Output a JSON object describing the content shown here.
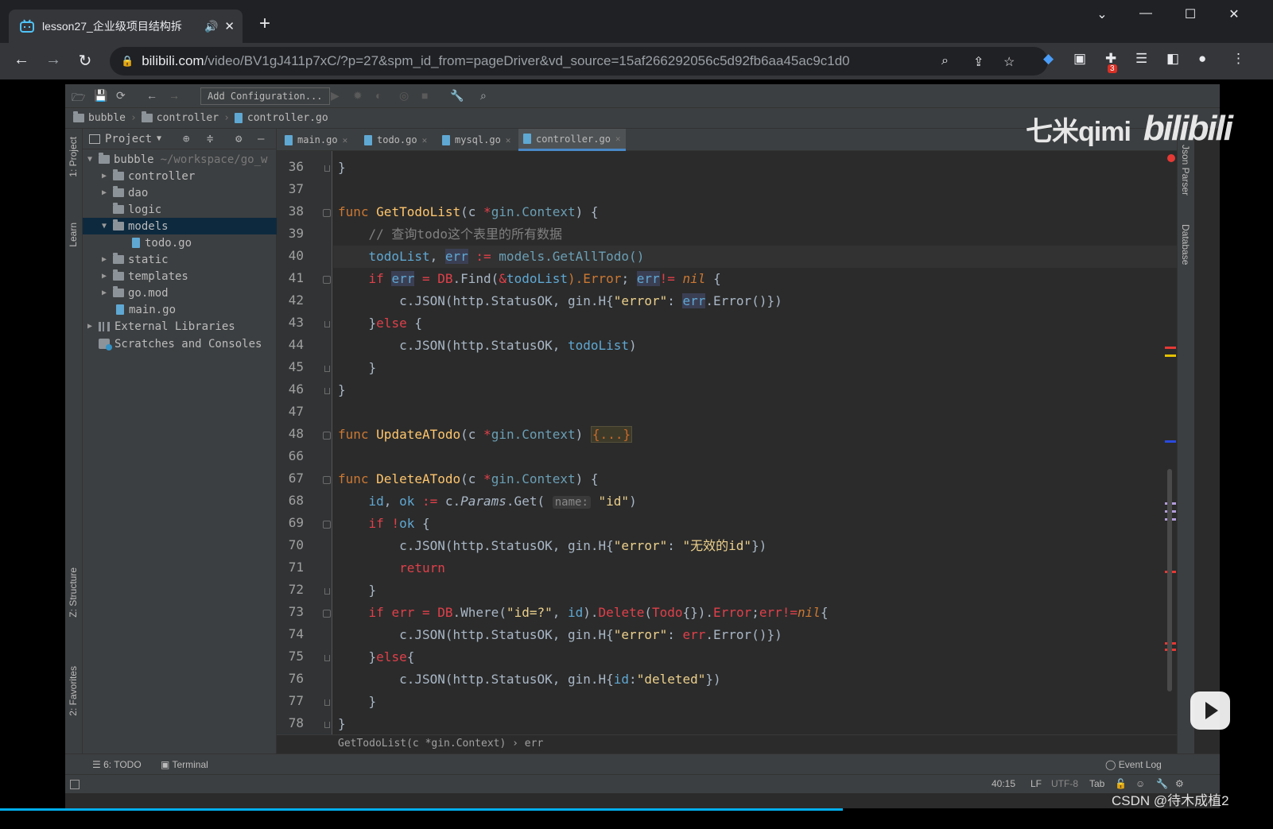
{
  "browser": {
    "tab_title": "lesson27_企业级项目结构拆",
    "url_host": "bilibili.com",
    "url_path": "/video/BV1gJ411p7xC/?p=27&spm_id_from=pageDriver&vd_source=15af266292056c5d92fb6aa45ac9c1d0",
    "extension_badge": "3"
  },
  "ide": {
    "toolbar": {
      "add_config_label": "Add Configuration..."
    },
    "breadcrumb": [
      "bubble",
      "controller",
      "controller.go"
    ],
    "left_tool_tabs": [
      "1: Project",
      "Learn",
      "Z: Structure",
      "2: Favorites"
    ],
    "right_tool_tabs": [
      "Json Parser",
      "Database"
    ],
    "project_panel": {
      "title": "Project",
      "tree": [
        {
          "label": "bubble",
          "hint": "~/workspace/go_w",
          "type": "folder",
          "expanded": true
        },
        {
          "label": "controller",
          "type": "folder"
        },
        {
          "label": "dao",
          "type": "folder"
        },
        {
          "label": "logic",
          "type": "folder"
        },
        {
          "label": "models",
          "type": "folder",
          "expanded": true,
          "selected": true
        },
        {
          "label": "todo.go",
          "type": "gofile"
        },
        {
          "label": "static",
          "type": "folder"
        },
        {
          "label": "templates",
          "type": "folder"
        },
        {
          "label": "go.mod",
          "type": "file"
        },
        {
          "label": "main.go",
          "type": "gofile"
        },
        {
          "label": "External Libraries",
          "type": "library"
        },
        {
          "label": "Scratches and Consoles",
          "type": "scratch"
        }
      ]
    },
    "editor_tabs": [
      {
        "label": "main.go",
        "active": false
      },
      {
        "label": "todo.go",
        "active": false
      },
      {
        "label": "mysql.go",
        "active": false
      },
      {
        "label": "controller.go",
        "active": true
      }
    ],
    "line_numbers": [
      "36",
      "37",
      "38",
      "39",
      "40",
      "41",
      "42",
      "43",
      "44",
      "45",
      "46",
      "47",
      "48",
      "66",
      "67",
      "68",
      "69",
      "70",
      "71",
      "72",
      "73",
      "74",
      "75",
      "76",
      "77",
      "78"
    ],
    "code": {
      "l36": "}",
      "l38_func": "func",
      "l38_name": "GetTodoList",
      "l38_params_a": "(c ",
      "l38_star": "*",
      "l38_type": "gin.Context",
      "l38_tail": ") {",
      "l39": "// 查询todo这个表里的所有数据",
      "l40_a": "todoList",
      "l40_b": ", ",
      "l40_c": "err",
      "l40_d": " := ",
      "l40_e": "models.GetAllTodo()",
      "l41_if": "if ",
      "l41_err": "err",
      "l41_eq": " = ",
      "l41_db": "DB",
      "l41_find": ".Find(",
      "l41_amp": "&",
      "l41_todo": "todoList",
      "l41_error": ").Error",
      "l41_semi": "; ",
      "l41_err2": "err",
      "l41_neq": "!= ",
      "l41_nil": "nil",
      "l41_brace": " {",
      "l42_a": "c.JSON(http.StatusOK, gin.H{",
      "l42_str": "\"error\"",
      "l42_colon": ": ",
      "l42_err": "err",
      "l42_tail": ".Error()})",
      "l43_a": "}",
      "l43_else": "else",
      "l43_b": " {",
      "l44_a": "c.JSON(http.StatusOK, ",
      "l44_var": "todoList",
      "l44_b": ")",
      "l45": "}",
      "l46": "}",
      "l48_func": "func",
      "l48_name": "UpdateATodo",
      "l48_params": "(c ",
      "l48_star": "*",
      "l48_type": "gin.Context",
      "l48_close": ") ",
      "l48_collapsed": "{...}",
      "l67_func": "func",
      "l67_name": "DeleteATodo",
      "l67_params": "(c ",
      "l67_star": "*",
      "l67_type": "gin.Context",
      "l67_tail": ") {",
      "l68_id": "id",
      "l68_comma": ", ",
      "l68_ok": "ok",
      "l68_assign": " := ",
      "l68_c": "c.",
      "l68_params": "Params",
      "l68_get": ".Get(",
      "l68_hint": "name:",
      "l68_str": "\"id\"",
      "l68_close": ")",
      "l69_if": "if ",
      "l69_not": "!",
      "l69_ok": "ok",
      "l69_brace": " {",
      "l70_a": "c.JSON(http.StatusOK, gin.H{",
      "l70_str": "\"error\"",
      "l70_colon": ": ",
      "l70_msg": "\"无效的id\"",
      "l70_tail": "})",
      "l71": "return",
      "l72": "}",
      "l73_if": "if ",
      "l73_err": "err",
      "l73_eq": " = ",
      "l73_db": "DB",
      "l73_where": ".Where(",
      "l73_str": "\"id=?\"",
      "l73_comma": ", ",
      "l73_id": "id",
      "l73_close": ").",
      "l73_delete": "Delete",
      "l73_paren": "(",
      "l73_todo": "Todo",
      "l73_brace": "{}).",
      "l73_error": "Error",
      "l73_semi": ";",
      "l73_err2": "err",
      "l73_neq": "!=",
      "l73_nil": "nil",
      "l73_open": "{",
      "l74_a": "c.JSON(http.StatusOK, gin.H{",
      "l74_str": "\"error\"",
      "l74_colon": ": ",
      "l74_err": "err",
      "l74_tail": ".Error()})",
      "l75_a": "}",
      "l75_else": "else",
      "l75_b": "{",
      "l76_a": "c.JSON(http.StatusOK, gin.H{",
      "l76_id": "id",
      "l76_colon": ":",
      "l76_str": "\"deleted\"",
      "l76_tail": "})",
      "l77": "}",
      "l78": "}"
    },
    "editor_breadcrumb": "GetTodoList(c *gin.Context) › err",
    "tool_windows": {
      "todo": "6: TODO",
      "terminal": "Terminal",
      "event_log": "Event Log"
    },
    "status": {
      "position": "40:15",
      "line_sep": "LF",
      "encoding": "UTF-8",
      "indent": "Tab"
    }
  },
  "overlay": {
    "watermark_qimi": "七米qimi",
    "watermark_bili": "bilibili",
    "csdn": "CSDN @待木成植2"
  },
  "colors": {
    "ide_bg": "#2b2b2b",
    "panel_bg": "#3c3f41",
    "keyword": "#cc7832",
    "function": "#ffc66d",
    "string": "#ecd08c",
    "accent": "#4a88c7"
  }
}
